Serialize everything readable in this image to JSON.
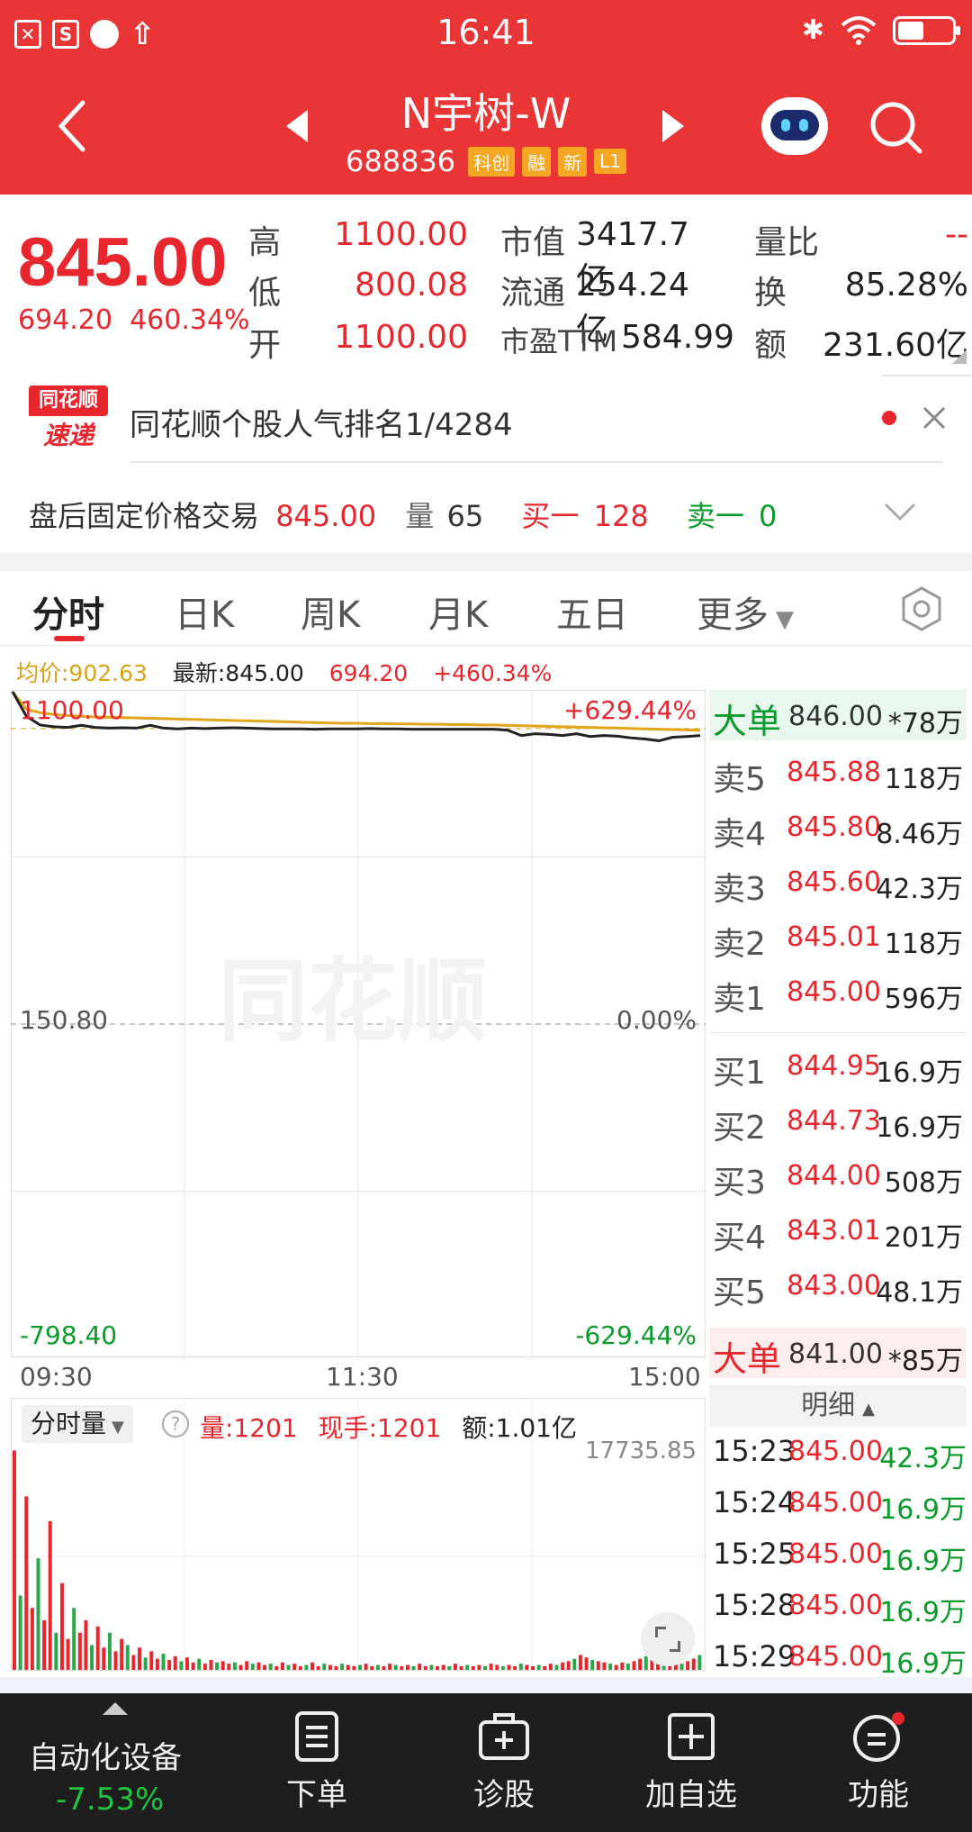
{
  "status": {
    "time": "16:41"
  },
  "header": {
    "stock_name": "N宇树-W",
    "stock_code": "688836",
    "tags": [
      "科创",
      "融",
      "新",
      "L1"
    ]
  },
  "quote": {
    "price": "845.00",
    "change": "694.20",
    "change_pct": "460.34%",
    "high_label": "高",
    "high": "1100.00",
    "low_label": "低",
    "low": "800.08",
    "open_label": "开",
    "open": "1100.00",
    "mktcap_label": "市值",
    "mktcap": "3417.7亿",
    "float_label": "流通",
    "float": "254.24亿",
    "pe_label": "市盈TTM",
    "pe": "584.99",
    "vol_ratio_label": "量比",
    "vol_ratio": "--",
    "turnover_label": "换",
    "turnover": "85.28%",
    "amount_label": "额",
    "amount": "231.60亿"
  },
  "notice": {
    "logo_top": "同花顺",
    "logo_bottom": "速递",
    "text": "同花顺个股人气排名1/4284"
  },
  "after_hours": {
    "label": "盘后固定价格交易",
    "price": "845.00",
    "vol_label": "量",
    "vol": "65",
    "buy1_label": "买一",
    "buy1": "128",
    "sell1_label": "卖一",
    "sell1": "0"
  },
  "tabs": [
    "分时",
    "日K",
    "周K",
    "月K",
    "五日",
    "更多"
  ],
  "chart_info": {
    "avg_label": "均价:902.63",
    "latest_label": "最新:845.00",
    "change": "694.20",
    "change_pct": "+460.34%"
  },
  "chart_data": {
    "type": "line",
    "y_top_label": "1100.00",
    "y_mid_label": "150.80",
    "y_bottom_label": "-798.40",
    "pct_top_label": "+629.44%",
    "pct_mid_label": "0.00%",
    "pct_bottom_label": "-629.44%",
    "x_labels": [
      "09:30",
      "11:30",
      "15:00"
    ],
    "ylim": [
      -798.4,
      1100.0
    ],
    "series": [
      {
        "name": "",
        "values": [
          1100,
          1030,
          1005,
          1000,
          998,
          1004,
          998,
          996,
          997,
          996,
          1004,
          996,
          994,
          996,
          995,
          996,
          997,
          996,
          995,
          994,
          994,
          994,
          993,
          994,
          994,
          994,
          995,
          994,
          994,
          993,
          993,
          993,
          993,
          993,
          993,
          993,
          990,
          975,
          980,
          978,
          975,
          980,
          972,
          975,
          973,
          968,
          965,
          960,
          970,
          972,
          975
        ]
      },
      {
        "name": "",
        "values": [
          1100,
          1050,
          1040,
          1035,
          1032,
          1030,
          1028,
          1027,
          1026,
          1025,
          1024,
          1023,
          1022,
          1021,
          1020,
          1019,
          1018,
          1017,
          1016,
          1015,
          1014,
          1013,
          1012,
          1011,
          1010,
          1010,
          1009,
          1009,
          1008,
          1008,
          1007,
          1007,
          1006,
          1006,
          1005,
          1005,
          1004,
          1003,
          1002,
          1001,
          1000,
          999,
          998,
          997,
          996,
          995,
          994,
          993,
          992,
          991,
          990
        ]
      }
    ],
    "volume_label_max": "17735.85",
    "volume": [
      17700,
      6000,
      14000,
      5000,
      9000,
      4000,
      12000,
      3000,
      7000,
      2500,
      5000,
      3000,
      4000,
      2000,
      3500,
      1800,
      3000,
      1500,
      2500,
      2000,
      1200,
      1800,
      1000,
      1500,
      900,
      1300,
      800,
      1100,
      700,
      1000,
      600,
      900,
      500,
      800,
      600,
      700,
      500,
      600,
      400,
      700,
      500,
      600,
      400,
      500,
      300,
      600,
      400,
      500,
      300,
      400,
      600,
      300,
      500,
      400,
      300,
      500,
      400,
      300,
      400,
      500,
      300,
      400,
      300,
      500,
      400,
      300,
      400,
      300,
      500,
      300,
      400,
      300,
      400,
      300,
      500,
      300,
      400,
      300,
      400,
      300,
      500,
      400,
      300,
      400,
      300,
      500,
      400,
      300,
      400,
      300,
      500,
      400,
      600,
      700,
      900,
      1200,
      1000,
      800,
      700,
      600,
      500,
      400,
      600,
      500,
      700,
      900,
      1100,
      1300,
      900,
      700,
      800,
      600,
      500,
      700,
      900,
      1200
    ]
  },
  "order_book": {
    "big_sell_label": "大单",
    "big_sell_price": "846.00",
    "big_sell_vol": "*78万",
    "asks": [
      {
        "label": "卖5",
        "price": "845.88",
        "vol": "118万"
      },
      {
        "label": "卖4",
        "price": "845.80",
        "vol": "8.46万"
      },
      {
        "label": "卖3",
        "price": "845.60",
        "vol": "42.3万"
      },
      {
        "label": "卖2",
        "price": "845.01",
        "vol": "118万"
      },
      {
        "label": "卖1",
        "price": "845.00",
        "vol": "596万"
      }
    ],
    "bids": [
      {
        "label": "买1",
        "price": "844.95",
        "vol": "16.9万"
      },
      {
        "label": "买2",
        "price": "844.73",
        "vol": "16.9万"
      },
      {
        "label": "买3",
        "price": "844.00",
        "vol": "508万"
      },
      {
        "label": "买4",
        "price": "843.01",
        "vol": "201万"
      },
      {
        "label": "买5",
        "price": "843.00",
        "vol": "48.1万"
      }
    ],
    "big_buy_label": "大单",
    "big_buy_price": "841.00",
    "big_buy_vol": "*85万"
  },
  "detail": {
    "header": "明细",
    "rows": [
      {
        "time": "15:23",
        "price": "845.00",
        "vol": "42.3万"
      },
      {
        "time": "15:24",
        "price": "845.00",
        "vol": "16.9万"
      },
      {
        "time": "15:25",
        "price": "845.00",
        "vol": "16.9万"
      },
      {
        "time": "15:28",
        "price": "845.00",
        "vol": "16.9万"
      },
      {
        "time": "15:29",
        "price": "845.00",
        "vol": "16.9万"
      }
    ]
  },
  "volume_bar": {
    "dropdown": "分时量",
    "vol": "量:1201",
    "hand": "现手:1201",
    "amount": "额:1.01亿"
  },
  "bottom_bar": {
    "sector": "自动化设备",
    "sector_change": "-7.53%",
    "items": [
      "下单",
      "诊股",
      "加自选",
      "功能"
    ]
  }
}
